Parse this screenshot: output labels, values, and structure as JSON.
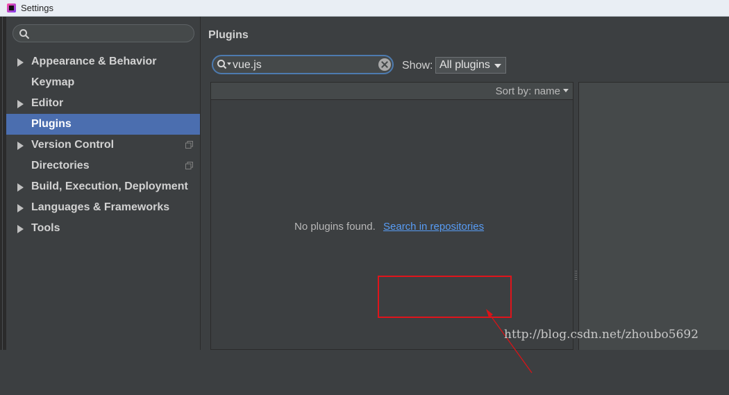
{
  "window": {
    "title": "Settings"
  },
  "sidebar": {
    "search_placeholder": "",
    "items": [
      {
        "label": "Appearance & Behavior",
        "expandable": true,
        "selected": false,
        "project_icon": false
      },
      {
        "label": "Keymap",
        "expandable": false,
        "selected": false,
        "project_icon": false
      },
      {
        "label": "Editor",
        "expandable": true,
        "selected": false,
        "project_icon": false
      },
      {
        "label": "Plugins",
        "expandable": false,
        "selected": true,
        "project_icon": false
      },
      {
        "label": "Version Control",
        "expandable": true,
        "selected": false,
        "project_icon": true
      },
      {
        "label": "Directories",
        "expandable": false,
        "selected": false,
        "project_icon": true
      },
      {
        "label": "Build, Execution, Deployment",
        "expandable": true,
        "selected": false,
        "project_icon": false
      },
      {
        "label": "Languages & Frameworks",
        "expandable": true,
        "selected": false,
        "project_icon": false
      },
      {
        "label": "Tools",
        "expandable": true,
        "selected": false,
        "project_icon": false
      }
    ]
  },
  "main": {
    "title": "Plugins",
    "search": {
      "value": "vue.js"
    },
    "show": {
      "label": "Show:",
      "selected": "All plugins"
    },
    "list": {
      "sort_label": "Sort by: name",
      "empty_message": "No plugins found.",
      "empty_link": "Search in repositories"
    }
  },
  "watermark": "http://blog.csdn.net/zhoubo5692",
  "colors": {
    "background": "#3c3f41",
    "selection": "#4b6eaf",
    "link": "#589df6",
    "highlight": "#e0141b"
  }
}
